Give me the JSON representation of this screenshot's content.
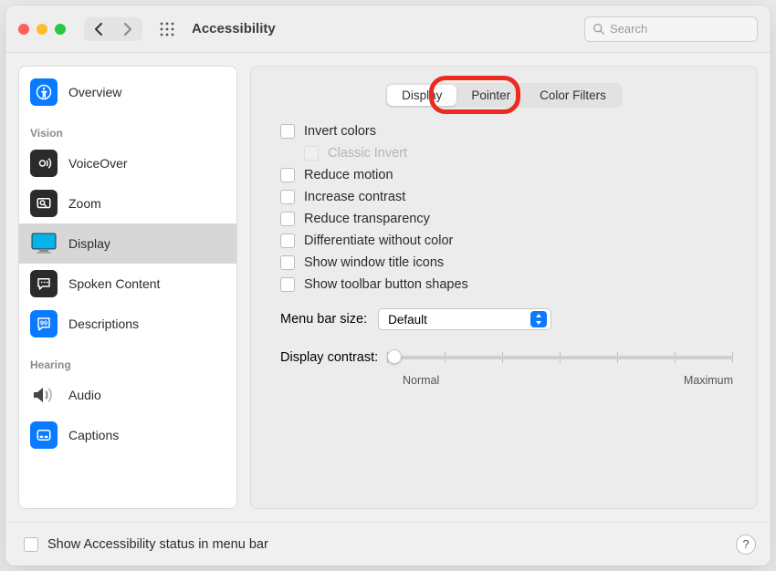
{
  "window": {
    "title": "Accessibility"
  },
  "search": {
    "placeholder": "Search"
  },
  "sidebar": {
    "items": [
      {
        "label": "Overview"
      },
      {
        "label": "VoiceOver"
      },
      {
        "label": "Zoom"
      },
      {
        "label": "Display"
      },
      {
        "label": "Spoken Content"
      },
      {
        "label": "Descriptions"
      },
      {
        "label": "Audio"
      },
      {
        "label": "Captions"
      }
    ],
    "section_vision": "Vision",
    "section_hearing": "Hearing"
  },
  "tabs": {
    "display": "Display",
    "pointer": "Pointer",
    "color_filters": "Color Filters"
  },
  "options": {
    "invert": "Invert colors",
    "classic_invert": "Classic Invert",
    "reduce_motion": "Reduce motion",
    "increase_contrast": "Increase contrast",
    "reduce_transparency": "Reduce transparency",
    "differentiate": "Differentiate without color",
    "window_title_icons": "Show window title icons",
    "toolbar_shapes": "Show toolbar button shapes"
  },
  "menubar": {
    "label": "Menu bar size:",
    "value": "Default"
  },
  "contrast": {
    "label": "Display contrast:",
    "min": "Normal",
    "max": "Maximum"
  },
  "footer": {
    "status_checkbox": "Show Accessibility status in menu bar"
  }
}
